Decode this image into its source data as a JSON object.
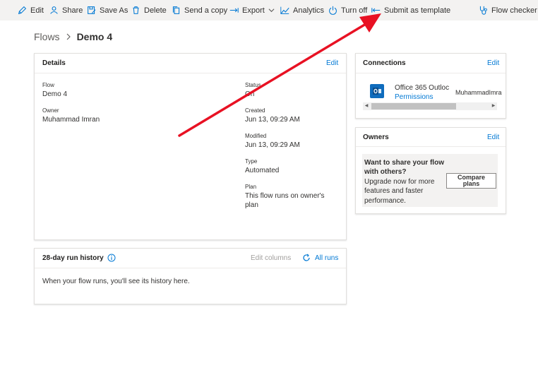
{
  "toolbar": {
    "edit": "Edit",
    "share": "Share",
    "save_as": "Save As",
    "delete": "Delete",
    "send_copy": "Send a copy",
    "export": "Export",
    "analytics": "Analytics",
    "turn_off": "Turn off",
    "submit_template": "Submit as template",
    "flow_checker": "Flow checker"
  },
  "breadcrumb": {
    "parent": "Flows",
    "current": "Demo 4"
  },
  "details": {
    "title": "Details",
    "edit": "Edit",
    "flow_label": "Flow",
    "flow_value": "Demo 4",
    "owner_label": "Owner",
    "owner_value": "Muhammad Imran",
    "status_label": "Status",
    "status_value": "On",
    "created_label": "Created",
    "created_value": "Jun 13, 09:29 AM",
    "modified_label": "Modified",
    "modified_value": "Jun 13, 09:29 AM",
    "type_label": "Type",
    "type_value": "Automated",
    "plan_label": "Plan",
    "plan_value_line1": "This flow runs on owner's",
    "plan_value_line2": "plan"
  },
  "run_history": {
    "title": "28-day run history",
    "edit_columns": "Edit columns",
    "all_runs": "All runs",
    "empty_message": "When your flow runs, you'll see its history here."
  },
  "connections": {
    "title": "Connections",
    "edit": "Edit",
    "name": "Office 365 Outloc",
    "permissions": "Permissions",
    "account": "MuhammadImra"
  },
  "owners": {
    "title": "Owners",
    "edit": "Edit",
    "share_line1": "Want to share your flow",
    "share_line2": "with others?",
    "upgrade_line1": "Upgrade now for more",
    "upgrade_line2": "features and faster",
    "upgrade_line3": "performance.",
    "compare_line1": "Compare",
    "compare_line2": "plans"
  },
  "colors": {
    "accent": "#0078d4",
    "annotation_arrow": "#e81123",
    "toolbar_bg": "#f3f2f1"
  }
}
